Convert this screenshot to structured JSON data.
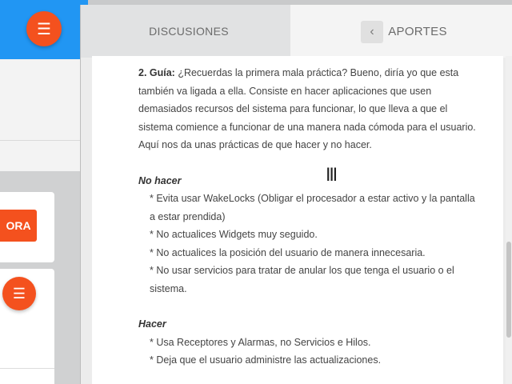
{
  "background_app": {
    "menu_icon": "hamburger-icon",
    "button_label": "ORA",
    "fab_icon": "hamburger-icon"
  },
  "tabs": {
    "discussions": "DISCUSIONES",
    "contributions": "APORTES",
    "back_icon": "chevron-left-icon"
  },
  "article": {
    "guide_label": "2. Guía:",
    "guide_text": " ¿Recuerdas la primera mala práctica? Bueno, diría yo que esta también va ligada a ella. Consiste en hacer aplicaciones que usen demasiados recursos del sistema para funcionar, lo que lleva a que el sistema comience a funcionar de una manera nada cómoda para el usuario. Aquí nos da unas prácticas de que hacer y no hacer.",
    "dont_heading": "No hacer",
    "dont_items": [
      "* Evita usar WakeLocks (Obligar el procesador a estar activo y la pantalla a estar prendida)",
      "* No actualices Widgets muy seguido.",
      "* No actualices la posición del usuario de manera innecesaria.",
      "* No usar servicios para tratar de anular los que tenga el usuario o el sistema."
    ],
    "do_heading": "Hacer",
    "do_items": [
      "* Usa Receptores y Alarmas, no Servicios e Hilos.",
      "* Deja que el usuario administre las actualizaciones."
    ]
  },
  "colors": {
    "accent_orange": "#f4511e",
    "topbar_blue": "#2196f3"
  }
}
